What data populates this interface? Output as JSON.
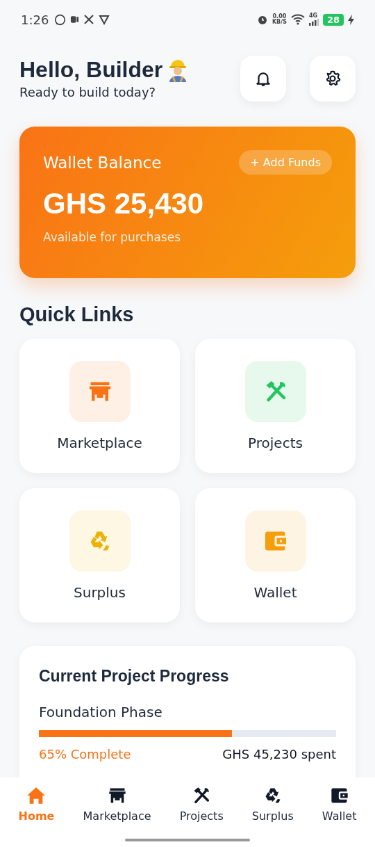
{
  "status_bar": {
    "time": "1:26",
    "net_speed": "0.00",
    "net_unit": "KB/S",
    "network": "4G",
    "battery": "28"
  },
  "header": {
    "greeting": "Hello, Builder",
    "subtitle": "Ready to build today?"
  },
  "wallet_card": {
    "title": "Wallet Balance",
    "button": "+ Add Funds",
    "balance": "GHS 25,430",
    "caption": "Available for purchases"
  },
  "quick_links": {
    "title": "Quick Links",
    "items": [
      {
        "label": "Marketplace",
        "kind": "store",
        "color": "#f97316"
      },
      {
        "label": "Projects",
        "kind": "tools",
        "color": "#22c55e"
      },
      {
        "label": "Surplus",
        "kind": "recycle",
        "color": "#eab308"
      },
      {
        "label": "Wallet",
        "kind": "wallet",
        "color": "#f59e0b"
      }
    ]
  },
  "progress_card": {
    "title": "Current Project Progress",
    "phase": "Foundation Phase",
    "level": 0.65,
    "percent": "65% Complete",
    "spent": "GHS 45,230 spent"
  },
  "bottom_nav": [
    {
      "label": "Home",
      "kind": "home",
      "selected": true
    },
    {
      "label": "Marketplace",
      "kind": "store",
      "selected": false
    },
    {
      "label": "Projects",
      "kind": "tools",
      "selected": false
    },
    {
      "label": "Surplus",
      "kind": "recycle",
      "selected": false
    },
    {
      "label": "Wallet",
      "kind": "wallet",
      "selected": false
    }
  ]
}
